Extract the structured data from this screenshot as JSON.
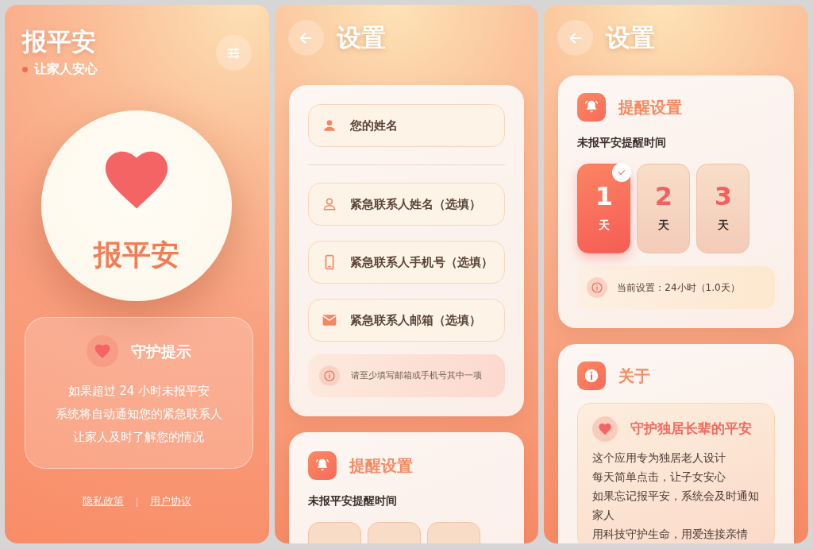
{
  "home": {
    "title": "报平安",
    "subtitle": "让家人安心",
    "check_in_label": "报平安",
    "tip": {
      "title": "守护提示",
      "lines": [
        "如果超过 24 小时未报平安",
        "系统将自动通知您的紧急联系人",
        "让家人及时了解您的情况"
      ]
    },
    "footer_links": [
      "隐私政策",
      "用户协议"
    ]
  },
  "settings_form": {
    "title": "设置",
    "fields": [
      {
        "kind": "person",
        "placeholder": "您的姓名"
      },
      {
        "kind": "person-outline",
        "placeholder": "紧急联系人姓名（选填）"
      },
      {
        "kind": "phone",
        "placeholder": "紧急联系人手机号（选填）"
      },
      {
        "kind": "mail",
        "placeholder": "紧急联系人邮箱（选填）"
      }
    ],
    "hint": "请至少填写邮箱或手机号其中一项",
    "reminder": {
      "title": "提醒设置",
      "label": "未报平安提醒时间"
    }
  },
  "settings_reminder": {
    "title": "设置",
    "reminder": {
      "title": "提醒设置",
      "label": "未报平安提醒时间",
      "options": [
        {
          "number": "1",
          "unit": "天",
          "selected": true
        },
        {
          "number": "2",
          "unit": "天",
          "selected": false
        },
        {
          "number": "3",
          "unit": "天",
          "selected": false
        }
      ],
      "current": "当前设置：24小时（1.0天）"
    },
    "about": {
      "title": "关于",
      "card_title": "守护独居长辈的平安",
      "lines": [
        "这个应用专为独居老人设计",
        "每天简单点击，让子女安心",
        "如果忘记报平安，系统会及时通知家人",
        "用科技守护生命，用爱连接亲情"
      ]
    }
  }
}
